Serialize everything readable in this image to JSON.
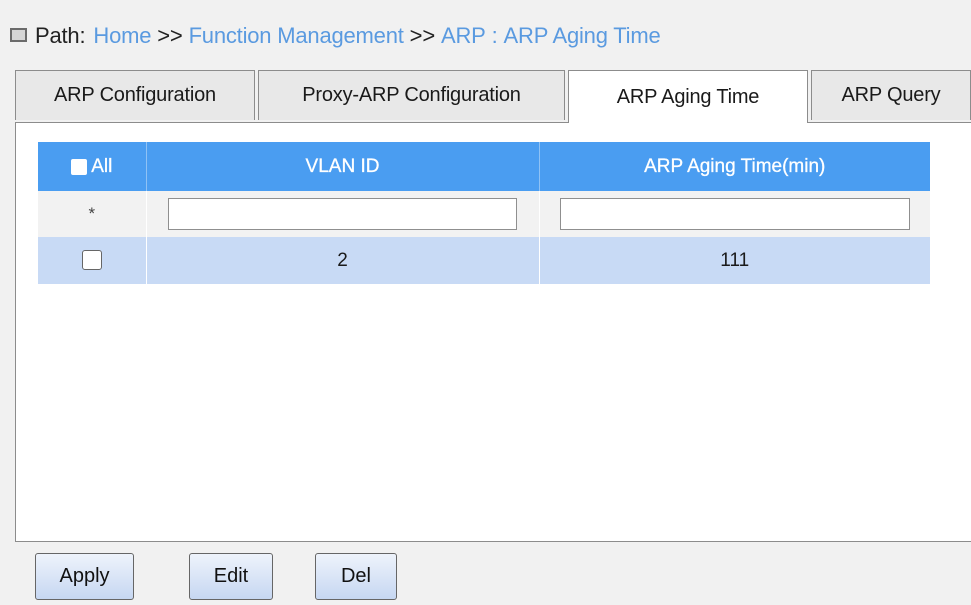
{
  "path": {
    "label": "Path:",
    "crumbs": [
      "Home",
      "Function Management",
      "ARP"
    ],
    "separator": ">>",
    "colon": ":",
    "current": "ARP Aging Time"
  },
  "tabs": [
    {
      "label": "ARP Configuration",
      "active": false
    },
    {
      "label": "Proxy-ARP Configuration",
      "active": false
    },
    {
      "label": "ARP Aging Time",
      "active": true
    },
    {
      "label": "ARP Query",
      "active": false
    }
  ],
  "table": {
    "headers": {
      "all": "All",
      "vlan_id": "VLAN ID",
      "aging_time": "ARP Aging Time(min)"
    },
    "filter_row": {
      "marker": "*",
      "vlan_id_value": "",
      "aging_time_value": ""
    },
    "rows": [
      {
        "checked": false,
        "vlan_id": "2",
        "aging_time": "111"
      }
    ]
  },
  "buttons": {
    "apply": "Apply",
    "edit": "Edit",
    "del": "Del"
  },
  "colors": {
    "header_bg": "#4a9df1",
    "link": "#5a9ae0",
    "selected_row": "#c8daf5"
  }
}
